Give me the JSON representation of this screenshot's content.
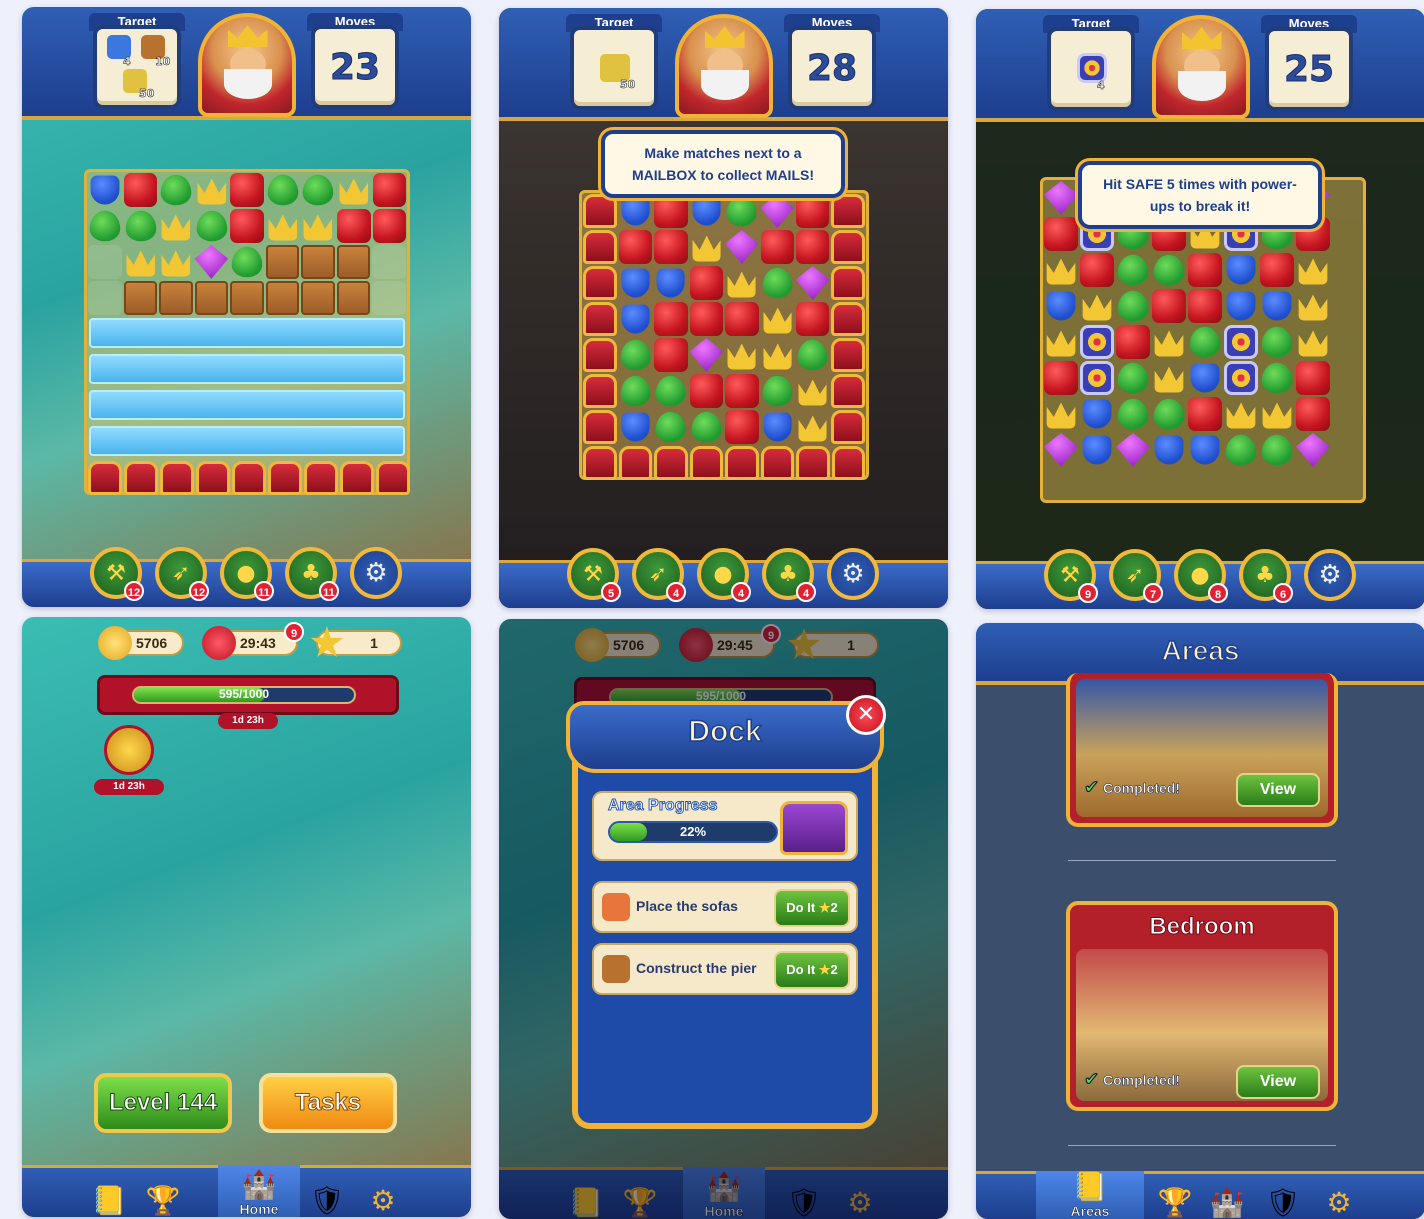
{
  "screen1": {
    "target_label": "Target",
    "moves_label": "Moves",
    "moves_value": "23",
    "targets": [
      {
        "icon": "blue-tile-icon",
        "count": "4"
      },
      {
        "icon": "box-icon",
        "count": "10"
      },
      {
        "icon": "mail-icon",
        "count": "50"
      }
    ],
    "boosters": [
      {
        "icon": "hammer-icon",
        "count": "12"
      },
      {
        "icon": "arrow-icon",
        "count": "12"
      },
      {
        "icon": "cannon-icon",
        "count": "11"
      },
      {
        "icon": "jester-hat-icon",
        "count": "11"
      }
    ]
  },
  "screen2": {
    "target_label": "Target",
    "moves_label": "Moves",
    "moves_value": "28",
    "targets": [
      {
        "icon": "mail-icon",
        "count": "50"
      }
    ],
    "tip": "Make matches next to a MAILBOX to collect MAILS!",
    "boosters": [
      {
        "icon": "hammer-icon",
        "count": "5"
      },
      {
        "icon": "arrow-icon",
        "count": "4"
      },
      {
        "icon": "cannon-icon",
        "count": "4"
      },
      {
        "icon": "jester-hat-icon",
        "count": "4"
      }
    ]
  },
  "screen3": {
    "target_label": "Target",
    "moves_label": "Moves",
    "moves_value": "25",
    "targets": [
      {
        "icon": "safe-icon",
        "count": "4"
      }
    ],
    "tip": "Hit SAFE 5 times with power-ups to break it!",
    "boosters": [
      {
        "icon": "hammer-icon",
        "count": "9"
      },
      {
        "icon": "arrow-icon",
        "count": "7"
      },
      {
        "icon": "cannon-icon",
        "count": "8"
      },
      {
        "icon": "jester-hat-icon",
        "count": "6"
      }
    ]
  },
  "screen4": {
    "coins": "5706",
    "lives_timer": "29:43",
    "lives_badge": "9",
    "stars": "1",
    "progress_text": "595/1000",
    "progress_fraction": 0.595,
    "progress_timer": "1d 23h",
    "trophy_timer": "1d 23h",
    "level_button": "Level 144",
    "tasks_button": "Tasks",
    "nav_home": "Home"
  },
  "screen5": {
    "coins": "5706",
    "lives_timer": "29:45",
    "lives_badge": "9",
    "stars": "1",
    "progress_text": "595/1000",
    "nav_home": "Home",
    "modal_title": "Dock",
    "area_progress_label": "Area Progress",
    "area_progress_pct": "22%",
    "area_progress_fraction": 0.22,
    "tasks": [
      {
        "label": "Place the sofas",
        "button": "Do It",
        "cost": "2"
      },
      {
        "label": "Construct the pier",
        "button": "Do It",
        "cost": "2"
      }
    ]
  },
  "screen6": {
    "title": "Areas",
    "areas": [
      {
        "name": "",
        "status": "Completed!",
        "button": "View"
      },
      {
        "name": "Bedroom",
        "status": "Completed!",
        "button": "View"
      }
    ],
    "nav_areas": "Areas"
  },
  "colors": {
    "header_blue": "#1e3e8e",
    "gold": "#f1b335",
    "green_button": "#2a7d18",
    "red": "#c41520"
  }
}
